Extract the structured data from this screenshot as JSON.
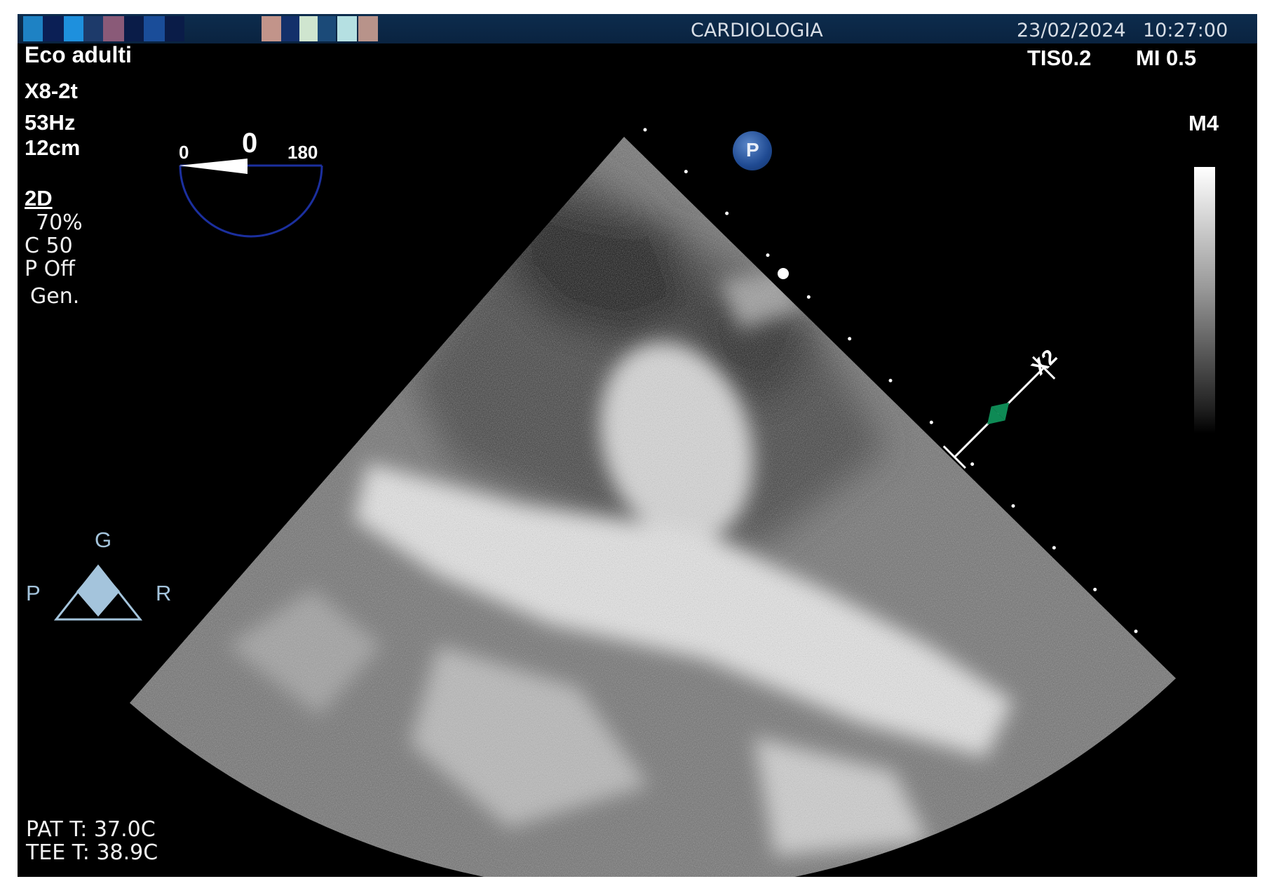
{
  "header": {
    "department": "CARDIOLOGIA",
    "date": "23/02/2024",
    "time": "10:27:00",
    "swatch_colors": [
      "#1e82c4",
      "#0b1f55",
      "#1e90dd",
      "#1d3a6a",
      "#8a5a78",
      "#0a1c48",
      "#1a4d99",
      "#0a1c48",
      "#c2948a",
      "#13306a",
      "#cfe5cf",
      "#1b4a78",
      "#b5e0e2",
      "#b8938a"
    ]
  },
  "acquisition": {
    "preset": "Eco adulti",
    "probe": "X8-2t",
    "frame_rate": "53Hz",
    "depth": "12cm",
    "mode": "2D",
    "gain": "70%",
    "compression": "C 50",
    "persistence": "P Off",
    "frequency": "Gen."
  },
  "safety": {
    "tis": "TIS0.2",
    "mi": "MI 0.5"
  },
  "map": {
    "label": "M4"
  },
  "omniplane": {
    "min_label": "0",
    "angle": "0",
    "max_label": "180"
  },
  "orientation": {
    "top": "G",
    "left": "P",
    "right": "R"
  },
  "zoom": {
    "label": "X2"
  },
  "marker": {
    "label": "P"
  },
  "temperatures": {
    "patient": "PAT T: 37.0C",
    "probe": "TEE T: 38.9C"
  },
  "colors": {
    "background": "#000000",
    "header": "#0d2c4d",
    "omni_arc": "#1b2f9e",
    "orientation_icon": "#a4c4dc",
    "zoom_arrow": "#0e8a55"
  }
}
